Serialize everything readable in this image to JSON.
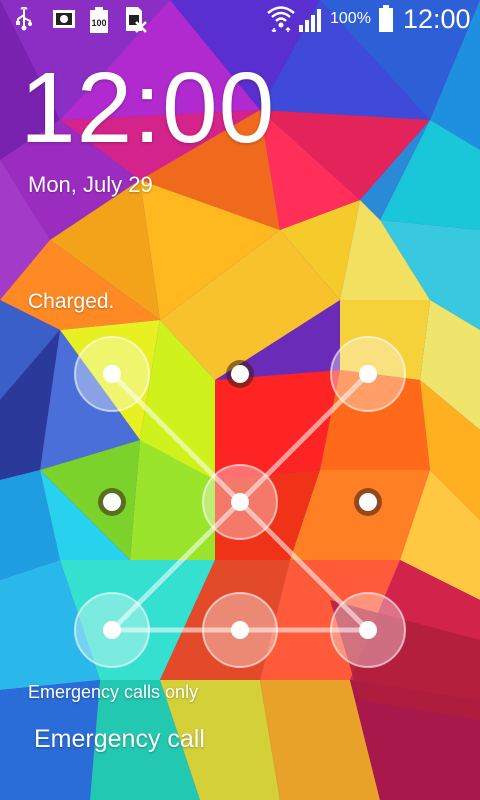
{
  "status_bar": {
    "battery_percent_label": "100%",
    "battery_icon_label": "100",
    "time": "12:00",
    "icons": [
      "usb-icon",
      "screenshot-icon",
      "battery-full-notification-icon",
      "no-sim-icon",
      "wifi-icon",
      "signal-icon",
      "battery-icon"
    ]
  },
  "lockscreen": {
    "clock": "12:00",
    "date": "Mon, July 29",
    "charge_status": "Charged.",
    "emergency_status": "Emergency calls only",
    "emergency_button": "Emergency call"
  },
  "pattern": {
    "grid": "3x3",
    "active_nodes": [
      1,
      3,
      5,
      7,
      8,
      9
    ],
    "path_order": [
      1,
      5,
      9,
      8,
      7,
      5,
      3
    ]
  },
  "colors": {
    "text": "#ffffff",
    "active_ring": "rgba(255,255,255,0.35)"
  }
}
